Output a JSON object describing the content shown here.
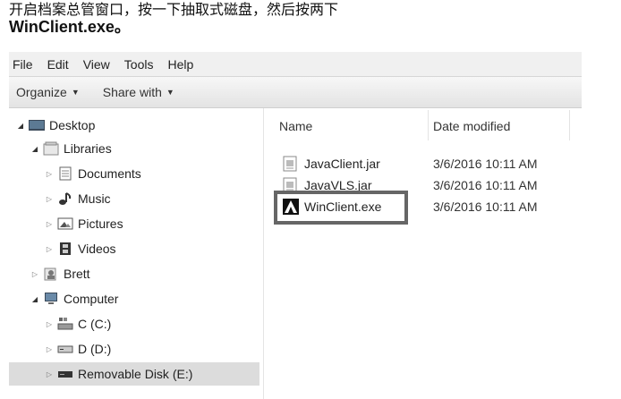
{
  "instruction": {
    "line1": "开启档案总管窗口，按一下抽取式磁盘，然后按两下",
    "line2": "WinClient.exe。"
  },
  "menubar": {
    "items": [
      "File",
      "Edit",
      "View",
      "Tools",
      "Help"
    ]
  },
  "toolbar": {
    "organize_label": "Organize",
    "share_label": "Share with"
  },
  "nav": {
    "desktop": "Desktop",
    "libraries": "Libraries",
    "documents": "Documents",
    "music": "Music",
    "pictures": "Pictures",
    "videos": "Videos",
    "user": "Brett",
    "computer": "Computer",
    "drive_c": "C (C:)",
    "drive_d": "D (D:)",
    "removable": "Removable Disk (E:)"
  },
  "content": {
    "col_name": "Name",
    "col_date": "Date modified",
    "files": [
      {
        "name": "JavaClient.jar",
        "date": "3/6/2016 10:11 AM",
        "icon": "jar-file-icon"
      },
      {
        "name": "JavaVLS.jar",
        "date": "3/6/2016 10:11 AM",
        "icon": "jar-file-icon"
      },
      {
        "name": "WinClient.exe",
        "date": "3/6/2016 10:11 AM",
        "icon": "app-exe-icon"
      }
    ]
  }
}
